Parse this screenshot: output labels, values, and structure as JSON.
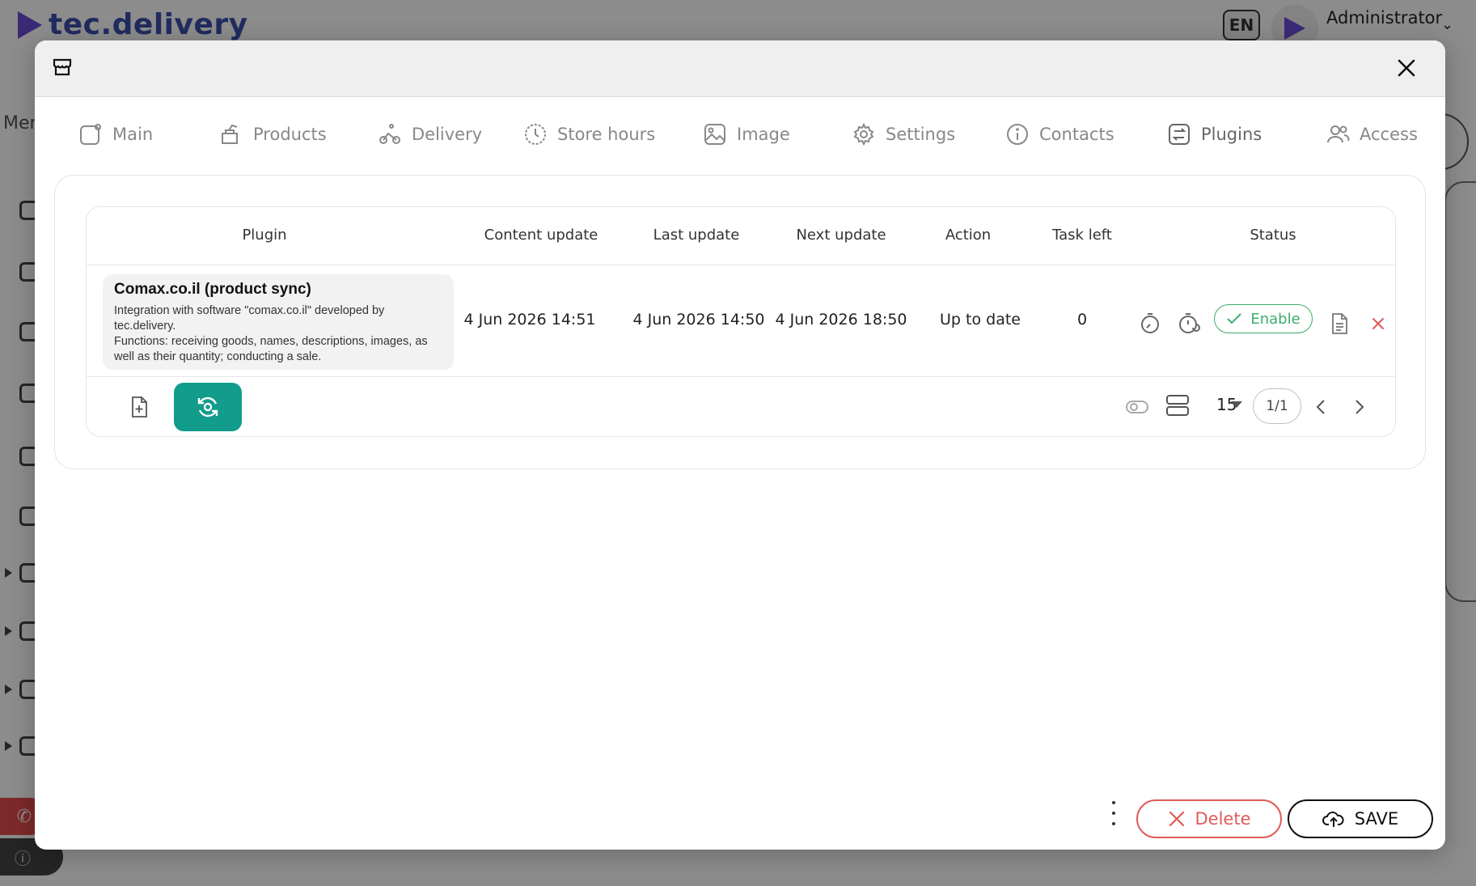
{
  "background": {
    "brand": "tec.delivery",
    "language": "EN",
    "user": "Administrator",
    "sidebar_label": "Men"
  },
  "modal": {
    "tabs": [
      {
        "label": "Main",
        "icon": "square-icon"
      },
      {
        "label": "Products",
        "icon": "products-icon"
      },
      {
        "label": "Delivery",
        "icon": "bike-icon"
      },
      {
        "label": "Store hours",
        "icon": "clock-icon"
      },
      {
        "label": "Image",
        "icon": "image-icon"
      },
      {
        "label": "Settings",
        "icon": "gear-icon"
      },
      {
        "label": "Contacts",
        "icon": "info-icon"
      },
      {
        "label": "Plugins",
        "icon": "plugins-icon"
      },
      {
        "label": "Access",
        "icon": "users-icon"
      }
    ],
    "active_tab": "Plugins",
    "table": {
      "columns": [
        "Plugin",
        "Content update",
        "Last update",
        "Next update",
        "Action",
        "Task left",
        "Status"
      ],
      "rows": [
        {
          "plugin_title": "Comax.co.il (product sync)",
          "plugin_desc_1": "Integration with software \"comax.co.il\" developed by tec.delivery.",
          "plugin_desc_2": "Functions: receiving goods, names, descriptions, images, as well as their quantity; conducting a sale.",
          "content_update": "4 Jun 2026 14:51",
          "last_update": "4 Jun 2026 14:50",
          "next_update": "4 Jun 2026 18:50",
          "action": "Up to date",
          "task_left": "0",
          "status": "Enable"
        }
      ],
      "page_size": "15",
      "page": "1/1"
    },
    "buttons": {
      "delete": "Delete",
      "save": "SAVE"
    }
  },
  "colors": {
    "accent": "#119c8c",
    "success": "#3cae6a",
    "danger": "#e05a5a",
    "brand": "#6c4bd8"
  }
}
